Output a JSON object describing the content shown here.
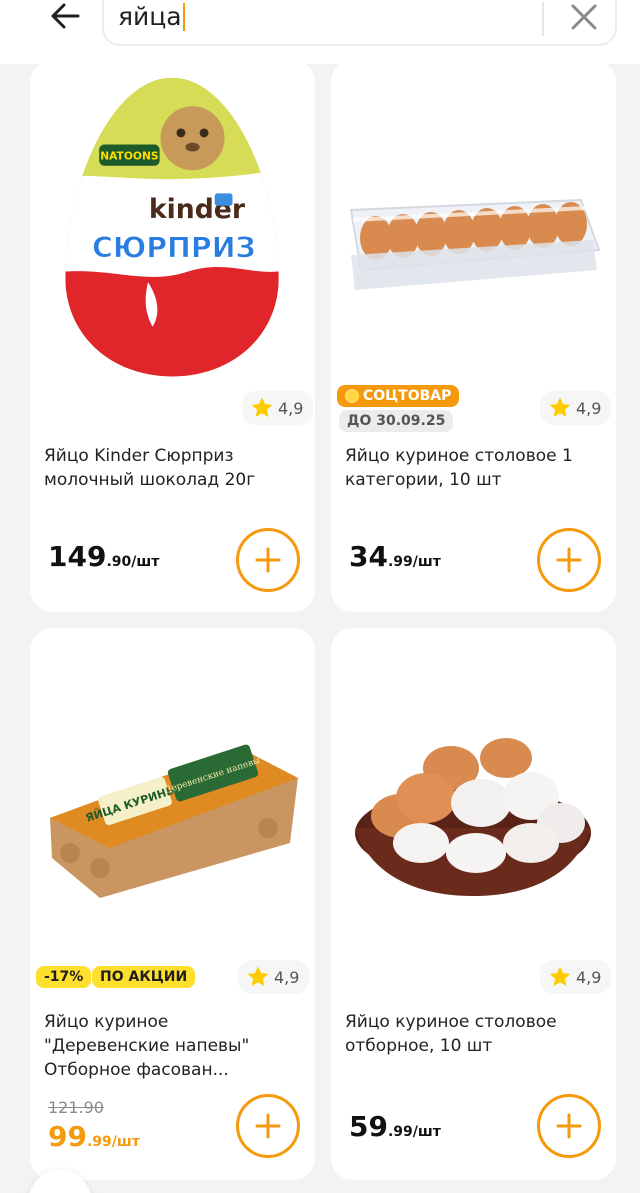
{
  "search": {
    "query": "яйца"
  },
  "colors": {
    "accent": "#f59a0c",
    "star": "#ffcc00",
    "promo_badge": "#ffdf2e"
  },
  "products": [
    {
      "title": "Яйцо Kinder Сюрприз молочный шоколад 20г",
      "rating": "4,9",
      "price_int": "149",
      "price_frac": ".90/шт",
      "image": "kinder-surprise-egg",
      "image_text": {
        "brand": "kinder",
        "product": "СЮРПРИЗ",
        "collection": "NATOONS"
      }
    },
    {
      "title": "Яйцо куриное столовое 1 категории, 10 шт",
      "rating": "4,9",
      "price_int": "34",
      "price_frac": ".99/шт",
      "badges": [
        "СОЦТОВАР",
        "ДО 30.09.25"
      ],
      "image": "eggs-plastic-tray"
    },
    {
      "title": "Яйцо куриное \"Деревенские напевы\" Отборное фасован...",
      "rating": "4,9",
      "old_price": "121.90",
      "price_int": "99",
      "price_frac": ".99/шт",
      "badges": [
        "-17%",
        "ПО АКЦИИ"
      ],
      "image": "eggs-carton-derevenskie-napevy",
      "image_text": {
        "label": "ЯЙЦА КУРИНЫЕ",
        "brand": "Деревенские напевы"
      }
    },
    {
      "title": "Яйцо куриное столовое отборное, 10 шт",
      "rating": "4,9",
      "price_int": "59",
      "price_frac": ".99/шт",
      "image": "eggs-in-bowl"
    }
  ]
}
